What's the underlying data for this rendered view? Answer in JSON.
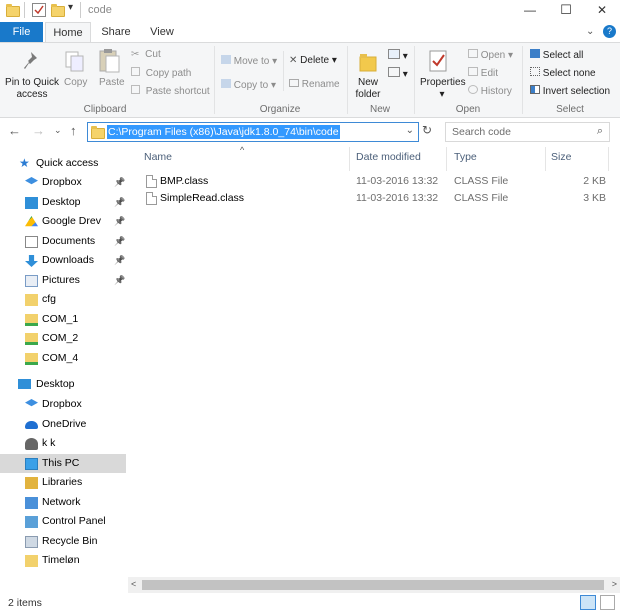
{
  "window": {
    "title": "code",
    "minimize": "—",
    "maximize": "☐",
    "close": "✕",
    "help": "?"
  },
  "tabs": {
    "file": "File",
    "home": "Home",
    "share": "Share",
    "view": "View"
  },
  "ribbon": {
    "clipboard": {
      "label": "Clipboard",
      "pin_quick_access": [
        "Pin to Quick",
        "access"
      ],
      "copy": "Copy",
      "paste": "Paste",
      "cut": "Cut",
      "copy_path": "Copy path",
      "paste_shortcut": "Paste shortcut"
    },
    "organize": {
      "label": "Organize",
      "move_to": "Move to",
      "copy_to": "Copy to",
      "delete": "Delete",
      "rename": "Rename"
    },
    "new": {
      "label": "New",
      "new_folder": [
        "New",
        "folder"
      ]
    },
    "open": {
      "label": "Open",
      "properties": "Properties",
      "open": "Open",
      "edit": "Edit",
      "history": "History"
    },
    "select": {
      "label": "Select",
      "select_all": "Select all",
      "select_none": "Select none",
      "invert_selection": "Invert selection"
    }
  },
  "address": {
    "path": "C:\\Program Files (x86)\\Java\\jdk1.8.0_74\\bin\\code",
    "search_placeholder": "Search code"
  },
  "nav": {
    "quick_access": "Quick access",
    "quick_items": [
      "Dropbox",
      "Desktop",
      "Google Drev",
      "Documents",
      "Downloads",
      "Pictures",
      "cfg",
      "COM_1",
      "COM_2",
      "COM_4"
    ],
    "desktop": "Desktop",
    "desktop_items": [
      "Dropbox",
      "OneDrive",
      "k k",
      "This PC",
      "Libraries",
      "Network",
      "Control Panel",
      "Recycle Bin",
      "Timeløn"
    ]
  },
  "columns": {
    "name": "Name",
    "date": "Date modified",
    "type": "Type",
    "size": "Size"
  },
  "files": [
    {
      "name": "BMP.class",
      "date": "11-03-2016 13:32",
      "type": "CLASS File",
      "size": "2 KB"
    },
    {
      "name": "SimpleRead.class",
      "date": "11-03-2016 13:32",
      "type": "CLASS File",
      "size": "3 KB"
    }
  ],
  "status": {
    "items": "2 items"
  },
  "colors": {
    "file_tab": "#1979ca",
    "address_highlight": "#3399ff",
    "selected_nav": "#d9d9d9"
  }
}
